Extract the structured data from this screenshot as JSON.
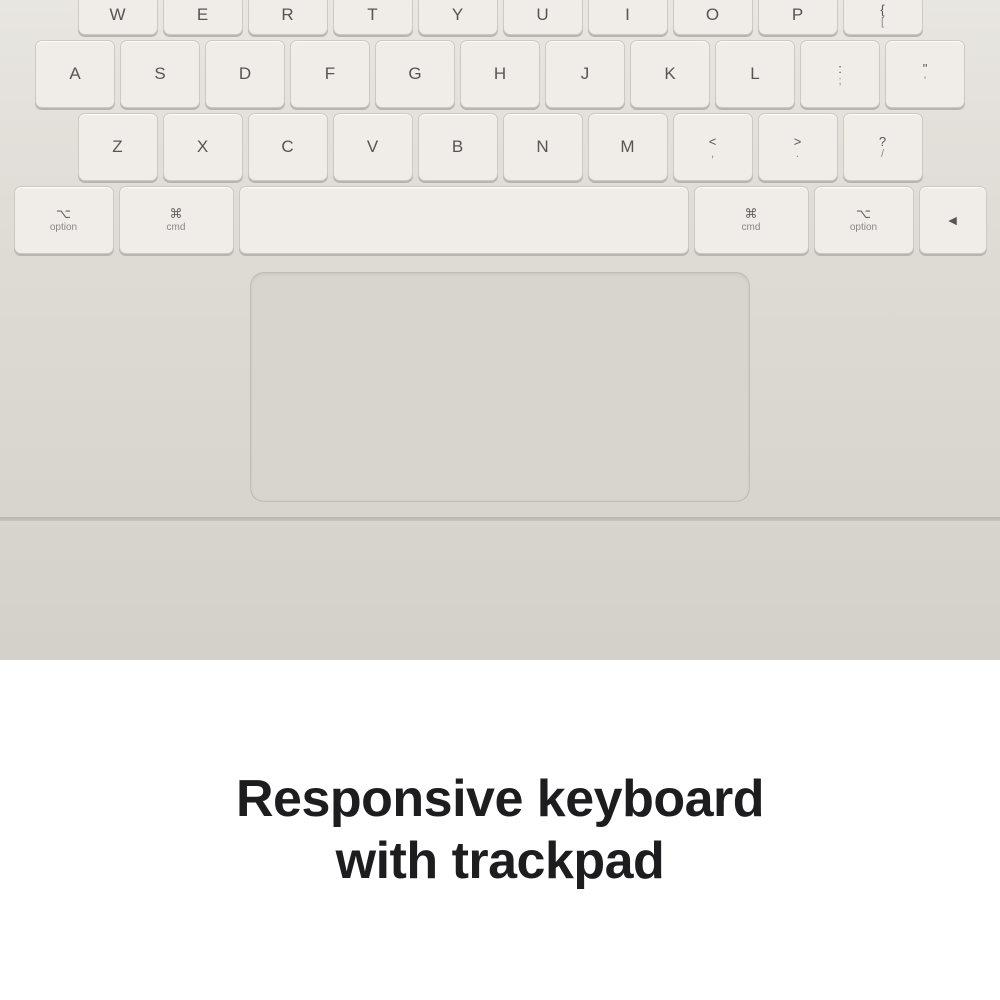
{
  "keyboard": {
    "rows": [
      {
        "id": "row1",
        "keys": [
          {
            "label": "W",
            "type": "standard"
          },
          {
            "label": "E",
            "type": "standard"
          },
          {
            "label": "R",
            "type": "standard"
          },
          {
            "label": "T",
            "type": "standard"
          },
          {
            "label": "Y",
            "type": "standard"
          },
          {
            "label": "U",
            "type": "standard"
          },
          {
            "label": "I",
            "type": "standard"
          },
          {
            "label": "O",
            "type": "standard"
          },
          {
            "label": "P",
            "type": "standard"
          },
          {
            "label": "{",
            "sub": "[",
            "type": "standard"
          }
        ]
      },
      {
        "id": "row2",
        "keys": [
          {
            "label": "A",
            "type": "standard"
          },
          {
            "label": "S",
            "type": "standard"
          },
          {
            "label": "D",
            "type": "standard"
          },
          {
            "label": "F",
            "type": "standard"
          },
          {
            "label": "G",
            "type": "standard"
          },
          {
            "label": "H",
            "type": "standard"
          },
          {
            "label": "J",
            "type": "standard"
          },
          {
            "label": "K",
            "type": "standard"
          },
          {
            "label": "L",
            "type": "standard"
          },
          {
            "label": ":",
            "sub": ";",
            "type": "standard"
          },
          {
            "label": "\"",
            "sub": "'",
            "type": "standard"
          }
        ]
      },
      {
        "id": "row3",
        "keys": [
          {
            "label": "Z",
            "type": "standard"
          },
          {
            "label": "X",
            "type": "standard"
          },
          {
            "label": "C",
            "type": "standard"
          },
          {
            "label": "V",
            "type": "standard"
          },
          {
            "label": "B",
            "type": "standard"
          },
          {
            "label": "N",
            "type": "standard"
          },
          {
            "label": "M",
            "type": "standard"
          },
          {
            "label": "<",
            "sub": ",",
            "type": "standard"
          },
          {
            "label": ">",
            "sub": ".",
            "type": "standard"
          },
          {
            "label": "?",
            "sub": "/",
            "type": "standard"
          }
        ]
      },
      {
        "id": "row4",
        "keys": [
          {
            "symbol": "⌥",
            "label": "option",
            "type": "modifier"
          },
          {
            "symbol": "⌘",
            "label": "cmd",
            "type": "cmd"
          },
          {
            "label": "",
            "type": "space"
          },
          {
            "symbol": "⌘",
            "label": "cmd",
            "type": "cmd"
          },
          {
            "symbol": "⌥",
            "label": "option",
            "type": "modifier"
          },
          {
            "label": "◄",
            "type": "arrow"
          }
        ]
      }
    ],
    "trackpad_aria": "trackpad"
  },
  "headline": {
    "line1": "Responsive keyboard",
    "line2": "with trackpad"
  }
}
